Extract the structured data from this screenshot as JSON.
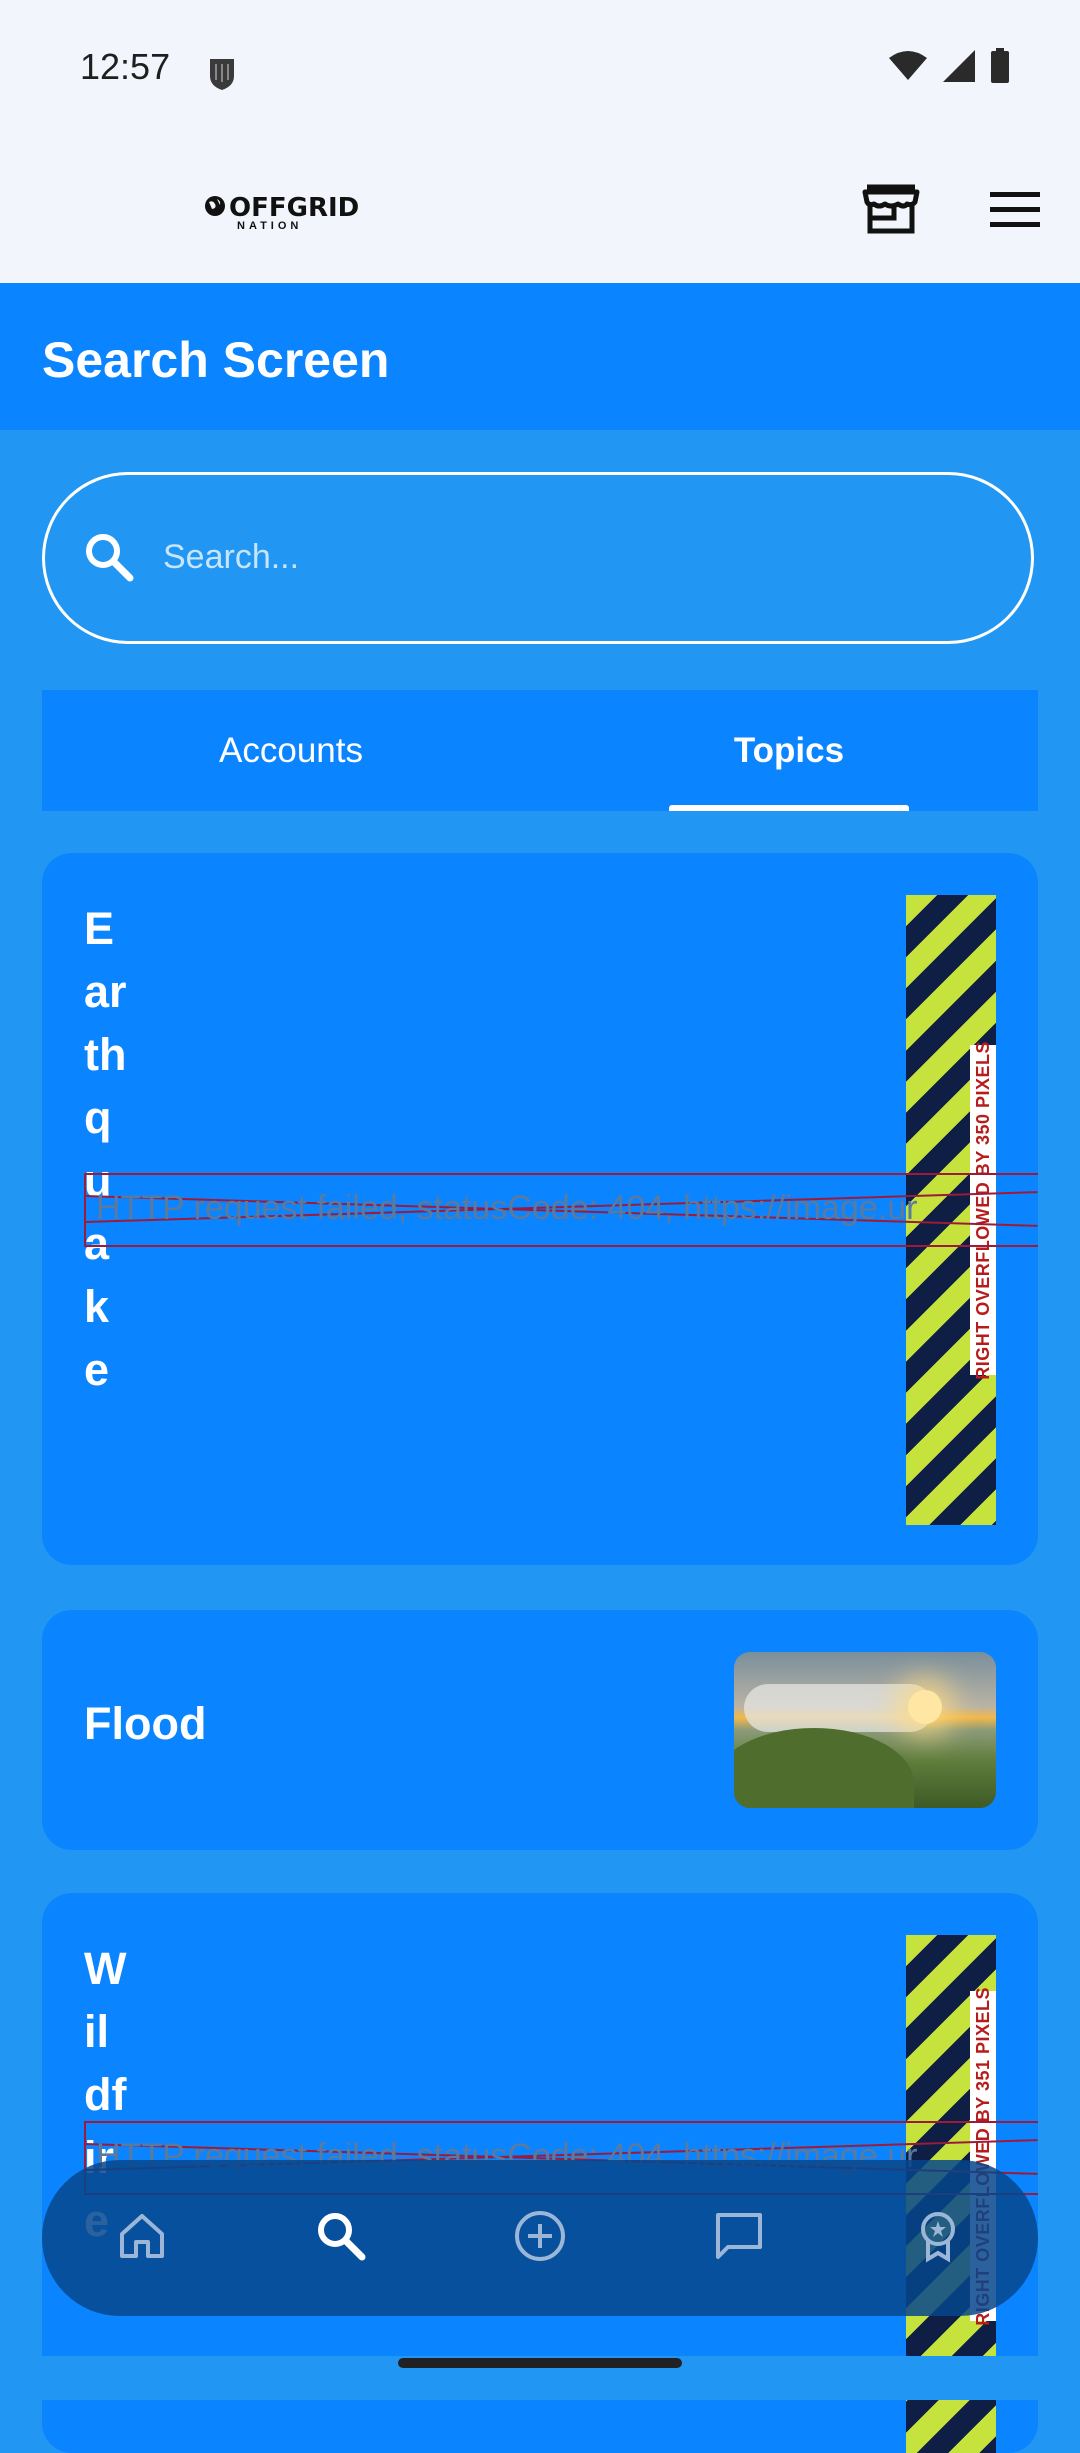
{
  "status_bar": {
    "time": "12:57",
    "icons": [
      "shield-icon",
      "wifi-icon",
      "signal-icon",
      "battery-icon"
    ]
  },
  "header": {
    "logo_text": "OFFGRID",
    "logo_subtext": "NATION",
    "icons": [
      "store-icon",
      "menu-icon"
    ]
  },
  "appbar": {
    "title": "Search Screen"
  },
  "search": {
    "placeholder": "Search...",
    "value": ""
  },
  "tabs": [
    {
      "label": "Accounts",
      "active": false
    },
    {
      "label": "Topics",
      "active": true
    }
  ],
  "topics": [
    {
      "title": "Earthquake",
      "error": "HTTP request failed, statusCode: 404, https://image.ur",
      "overflow": "RIGHT OVERFLOWED BY 350 PIXELS"
    },
    {
      "title": "Flood",
      "image": "landscape-photo"
    },
    {
      "title": "Wildfire",
      "error": "HTTP request failed, statusCode: 404, https://image.ur",
      "overflow": "RIGHT OVERFLOWED BY 351 PIXELS"
    }
  ],
  "bottom_nav": [
    "home-icon",
    "search-icon",
    "add-circle-icon",
    "chat-icon",
    "award-icon"
  ],
  "colors": {
    "primary": "#0A84FF",
    "background": "#2196F3",
    "nav": "#06468C",
    "stripe_yellow": "#C6E23C",
    "stripe_navy": "#0E1E45",
    "overflow_text": "#B71C1C"
  }
}
